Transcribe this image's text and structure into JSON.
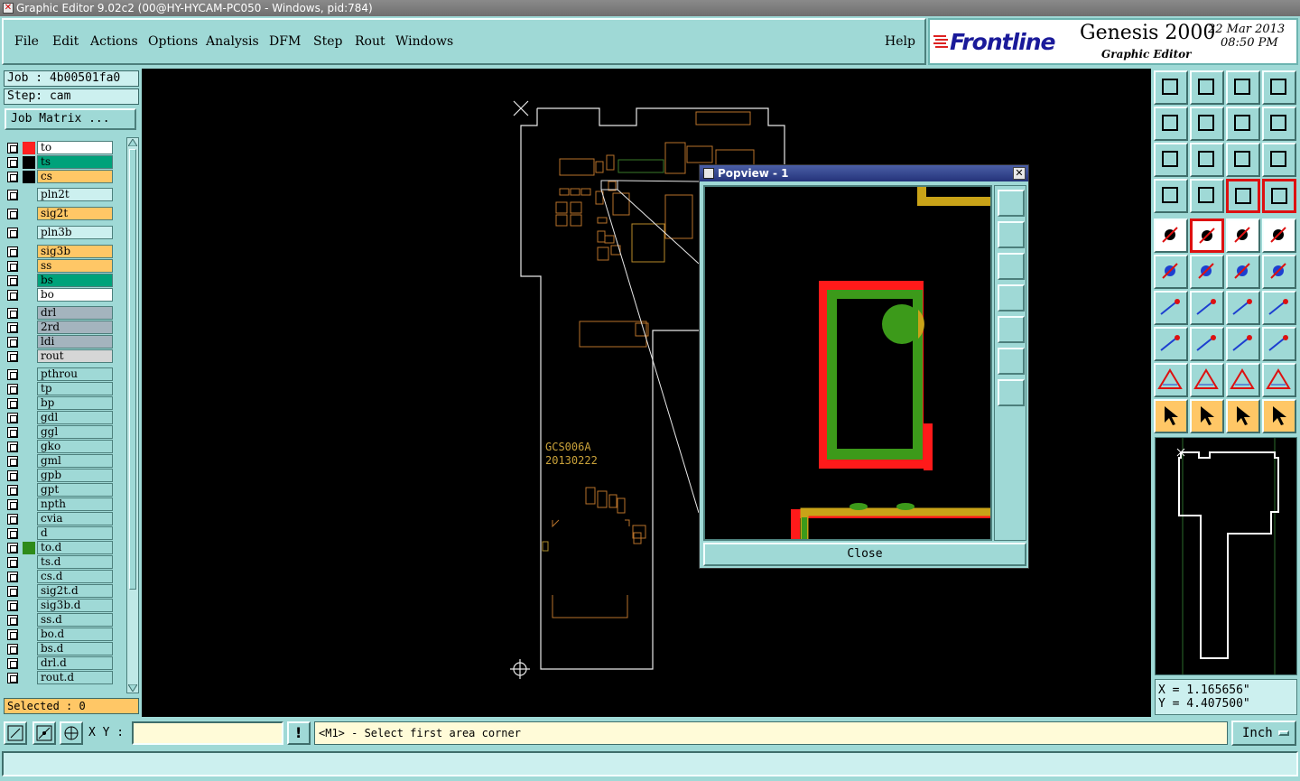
{
  "window": {
    "title": "Graphic Editor 9.02c2 (00@HY-HYCAM-PC050 - Windows, pid:784)"
  },
  "menu": {
    "items": [
      "File",
      "Edit",
      "Actions",
      "Options",
      "Analysis",
      "DFM",
      "Step",
      "Rout",
      "Windows"
    ],
    "help": "Help"
  },
  "brand": {
    "logo": "Frontline",
    "product": "Genesis 2000",
    "subtitle": "Graphic Editor",
    "date": "22 Mar 2013",
    "time": "08:50 PM"
  },
  "job": {
    "job_label": "Job : 4b00501fa0",
    "step_label": "Step: cam",
    "matrix_button": "Job Matrix ..."
  },
  "layers": [
    {
      "name": "to",
      "color": "#ffffff",
      "swatch": "#ff2020"
    },
    {
      "name": "ts",
      "color": "#00a27a",
      "swatch": "#000000"
    },
    {
      "name": "cs",
      "color": "#ffc766",
      "swatch": "#000000"
    },
    {
      "name": "pln2t",
      "color": "#ccf0ef",
      "swatch": ""
    },
    {
      "name": "sig2t",
      "color": "#ffc766",
      "swatch": ""
    },
    {
      "name": "pln3b",
      "color": "#ccf0ef",
      "swatch": ""
    },
    {
      "name": "sig3b",
      "color": "#ffc766",
      "swatch": ""
    },
    {
      "name": "ss",
      "color": "#ffc766",
      "swatch": ""
    },
    {
      "name": "bs",
      "color": "#00a27a",
      "swatch": ""
    },
    {
      "name": "bo",
      "color": "#ffffff",
      "swatch": ""
    },
    {
      "name": "drl",
      "color": "#a4b4be",
      "swatch": ""
    },
    {
      "name": "2rd",
      "color": "#a4b4be",
      "swatch": ""
    },
    {
      "name": "ldi",
      "color": "#a4b4be",
      "swatch": ""
    },
    {
      "name": "rout",
      "color": "#d6d6d6",
      "swatch": ""
    },
    {
      "name": "pthrou",
      "color": "#9fd9d6",
      "swatch": ""
    },
    {
      "name": "tp",
      "color": "#9fd9d6",
      "swatch": ""
    },
    {
      "name": "bp",
      "color": "#9fd9d6",
      "swatch": ""
    },
    {
      "name": "gdl",
      "color": "#9fd9d6",
      "swatch": ""
    },
    {
      "name": "ggl",
      "color": "#9fd9d6",
      "swatch": ""
    },
    {
      "name": "gko",
      "color": "#9fd9d6",
      "swatch": ""
    },
    {
      "name": "gml",
      "color": "#9fd9d6",
      "swatch": ""
    },
    {
      "name": "gpb",
      "color": "#9fd9d6",
      "swatch": ""
    },
    {
      "name": "gpt",
      "color": "#9fd9d6",
      "swatch": ""
    },
    {
      "name": "npth",
      "color": "#9fd9d6",
      "swatch": ""
    },
    {
      "name": "cvia",
      "color": "#9fd9d6",
      "swatch": ""
    },
    {
      "name": "d",
      "color": "#9fd9d6",
      "swatch": ""
    },
    {
      "name": "to.d",
      "color": "#9fd9d6",
      "swatch": "#2e8b1a"
    },
    {
      "name": "ts.d",
      "color": "#9fd9d6",
      "swatch": ""
    },
    {
      "name": "cs.d",
      "color": "#9fd9d6",
      "swatch": ""
    },
    {
      "name": "sig2t.d",
      "color": "#9fd9d6",
      "swatch": ""
    },
    {
      "name": "sig3b.d",
      "color": "#9fd9d6",
      "swatch": ""
    },
    {
      "name": "ss.d",
      "color": "#9fd9d6",
      "swatch": ""
    },
    {
      "name": "bo.d",
      "color": "#9fd9d6",
      "swatch": ""
    },
    {
      "name": "bs.d",
      "color": "#9fd9d6",
      "swatch": ""
    },
    {
      "name": "drl.d",
      "color": "#9fd9d6",
      "swatch": ""
    },
    {
      "name": "rout.d",
      "color": "#9fd9d6",
      "swatch": ""
    }
  ],
  "selected": "Selected : 0",
  "canvas": {
    "text_line1": "GCS006A",
    "text_line2": "20130222"
  },
  "popview": {
    "title": "Popview - 1",
    "close_label": "Close"
  },
  "coords": {
    "x": "X = 1.165656\"",
    "y": "Y = 4.407500\""
  },
  "bottom": {
    "xy_label": "X Y :",
    "xy_value": "",
    "prompt": "<M1> - Select first area corner",
    "units": "Inch"
  }
}
